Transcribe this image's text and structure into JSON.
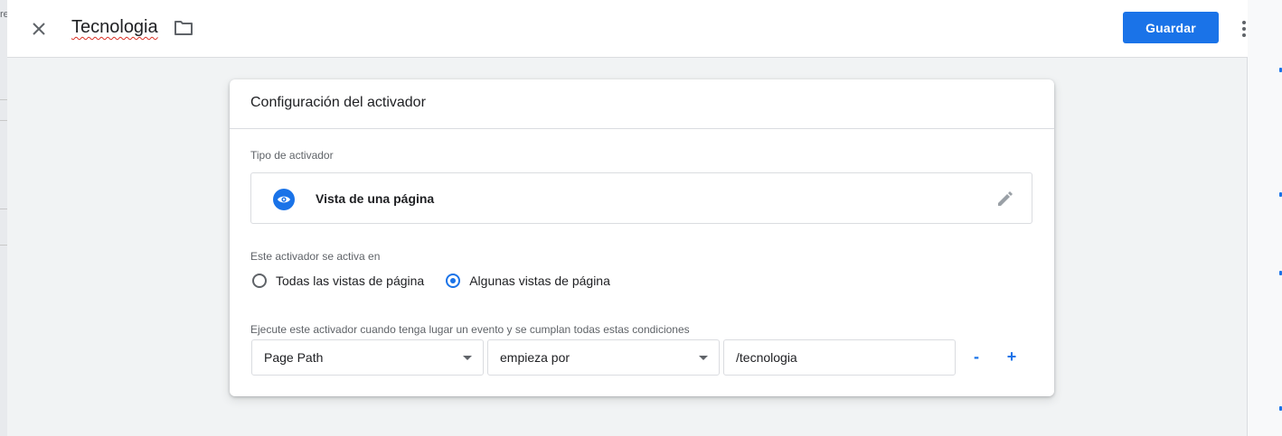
{
  "topbar": {
    "title": "Tecnologia",
    "save_label": "Guardar"
  },
  "background": {
    "left_edge_char": "re"
  },
  "card": {
    "header": "Configuración del activador",
    "trigger_type_label": "Tipo de activador",
    "trigger_type_name": "Vista de una página",
    "fires_on_label": "Este activador se activa en",
    "radio_options": [
      {
        "label": "Todas las vistas de página",
        "checked": false
      },
      {
        "label": "Algunas vistas de página",
        "checked": true
      }
    ],
    "conditions_label": "Ejecute este activador cuando tenga lugar un evento y se cumplan todas estas condiciones",
    "condition": {
      "variable": "Page Path",
      "operator": "empieza por",
      "value": "/tecnologia"
    },
    "remove_label": "-",
    "add_label": "+"
  },
  "colors": {
    "accent": "#1a73e8",
    "background": "#f1f3f4",
    "error_underline": "#d93025"
  },
  "icons": [
    "close-icon",
    "folder-icon",
    "more-vert-icon",
    "eye-icon",
    "pencil-icon"
  ]
}
